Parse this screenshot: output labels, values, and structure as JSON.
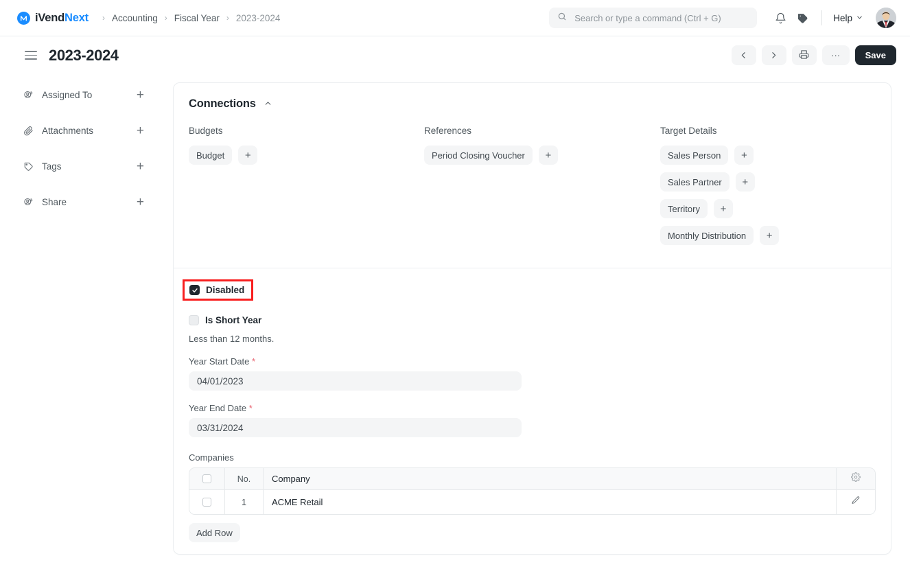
{
  "navbar": {
    "brand": {
      "part1": "iVend",
      "part2": "Next",
      "mark": "logo-icon"
    },
    "breadcrumbs": [
      {
        "label": "Accounting",
        "muted": false
      },
      {
        "label": "Fiscal Year",
        "muted": false
      },
      {
        "label": "2023-2024",
        "muted": true
      }
    ],
    "separator": "›",
    "search": {
      "placeholder": "Search or type a command (Ctrl + G)",
      "value": ""
    },
    "icons": [
      "notifications-icon",
      "tag-icon"
    ],
    "help": {
      "label": "Help",
      "caret": "ˇ"
    },
    "avatar": "user-avatar"
  },
  "pagehead": {
    "title": "2023-2024",
    "toolbar": {
      "prev": "‹",
      "next": "›",
      "print": "print-icon",
      "more": "···",
      "save": "Save"
    }
  },
  "sidebar": {
    "items": [
      {
        "label": "Assigned To",
        "icon": "assign-user-icon",
        "action": "+"
      },
      {
        "label": "Attachments",
        "icon": "paperclip-icon",
        "action": "+"
      },
      {
        "label": "Tags",
        "icon": "tag-icon",
        "action": "+"
      },
      {
        "label": "Share",
        "icon": "share-user-icon",
        "action": "+"
      }
    ]
  },
  "connections": {
    "title": "Connections",
    "collapse_caret": "∧",
    "columns": [
      {
        "title": "Budgets",
        "chips": [
          {
            "label": "Budget",
            "add": "+"
          }
        ]
      },
      {
        "title": "References",
        "chips": [
          {
            "label": "Period Closing Voucher",
            "add": "+"
          }
        ]
      },
      {
        "title": "Target Details",
        "chips": [
          {
            "label": "Sales Person",
            "add": "+"
          },
          {
            "label": "Sales Partner",
            "add": "+"
          },
          {
            "label": "Territory",
            "add": "+"
          },
          {
            "label": "Monthly Distribution",
            "add": "+"
          }
        ]
      }
    ]
  },
  "form": {
    "disabled": {
      "label": "Disabled",
      "checked": true,
      "highlight_color": "#f81f1f"
    },
    "is_short_year": {
      "label": "Is Short Year",
      "checked": false
    },
    "short_year_help": "Less than 12 months.",
    "year_start": {
      "label": "Year Start Date",
      "required": "*",
      "value": "04/01/2023"
    },
    "year_end": {
      "label": "Year End Date",
      "required": "*",
      "value": "03/31/2024"
    },
    "companies": {
      "label": "Companies",
      "headers": {
        "no": "No.",
        "company": "Company",
        "settings": "gear-icon"
      },
      "rows": [
        {
          "no": "1",
          "company": "ACME Retail",
          "edit": "edit-pencil-icon"
        }
      ],
      "add_row": "Add Row"
    }
  }
}
